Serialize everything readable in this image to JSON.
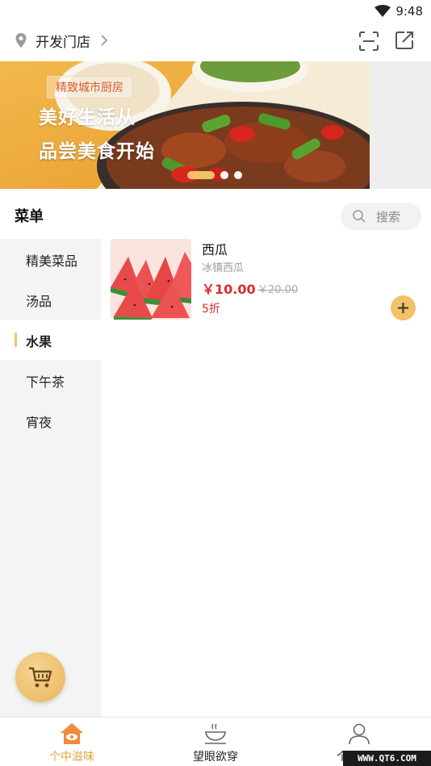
{
  "status_bar": {
    "time": "9:48",
    "wifi_icon": "wifi-icon"
  },
  "header": {
    "store_name": "开发门店",
    "location_icon": "location-pin-icon",
    "chevron_icon": "chevron-right-icon",
    "scan_icon": "scan-icon",
    "share_icon": "share-icon"
  },
  "banner": {
    "tag": "精致城市厨房",
    "line1": "美好生活从",
    "line2": "品尝美食开始",
    "slide_count": 3,
    "active_slide": 1
  },
  "menu": {
    "title": "菜单",
    "search_placeholder": "搜索",
    "categories": [
      {
        "label": "精美菜品",
        "active": false
      },
      {
        "label": "汤品",
        "active": false
      },
      {
        "label": "水果",
        "active": true
      },
      {
        "label": "下午茶",
        "active": false
      },
      {
        "label": "宵夜",
        "active": false
      }
    ]
  },
  "products": [
    {
      "name": "西瓜",
      "description": "冰镇西瓜",
      "price": "￥10.00",
      "original_price": "￥20.00",
      "discount": "5折",
      "add_label": "+"
    }
  ],
  "cart": {
    "icon": "cart-icon"
  },
  "bottom_nav": {
    "tabs": [
      {
        "label": "个中滋味",
        "icon": "house-eye-icon",
        "active": true
      },
      {
        "label": "望眼欲穿",
        "icon": "teacup-icon",
        "active": false
      },
      {
        "label": "个人中心",
        "icon": "user-icon",
        "active": false
      }
    ]
  },
  "watermark": "WWW.QT6.COM",
  "colors": {
    "accent": "#f2c168",
    "price_red": "#e02b2b",
    "active_tab": "#e8a33c"
  }
}
